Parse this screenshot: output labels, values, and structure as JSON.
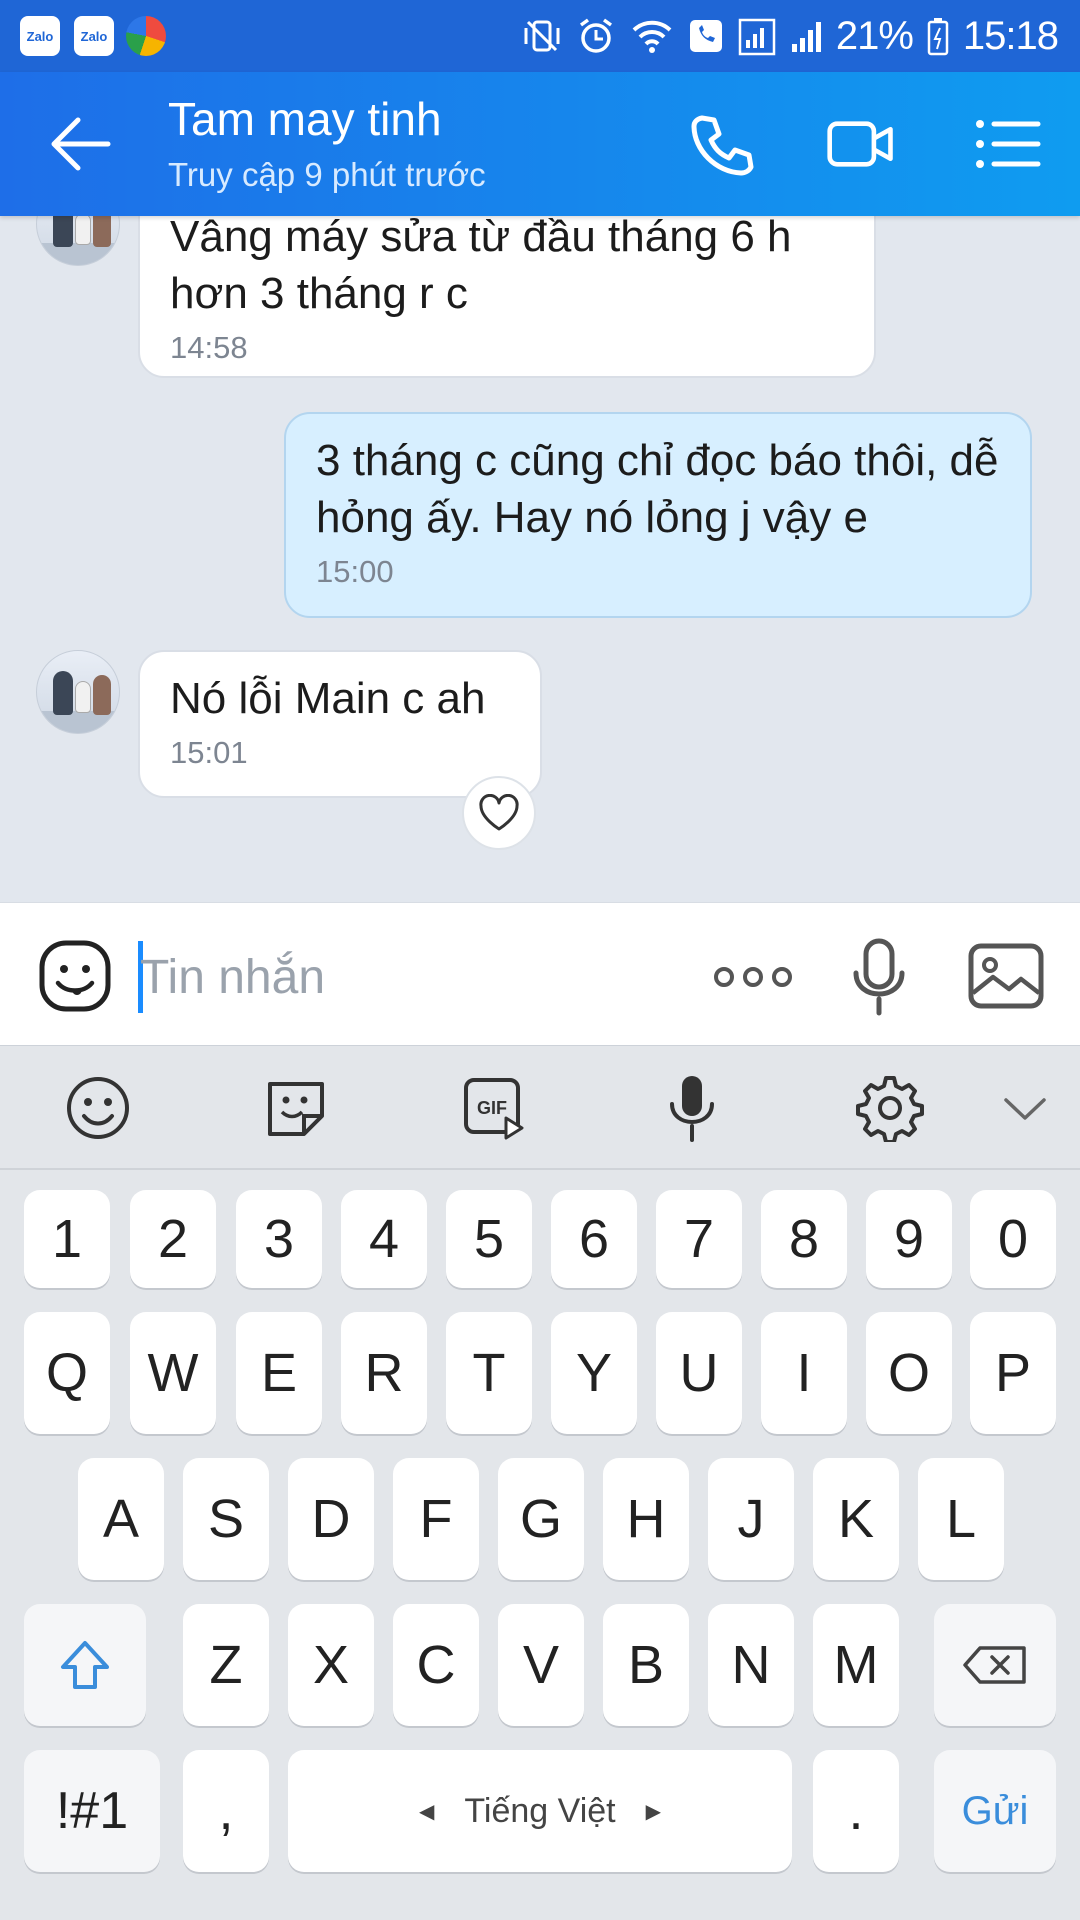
{
  "status_bar": {
    "apps": [
      "Zalo",
      "Zalo"
    ],
    "battery": "21%",
    "time": "15:18"
  },
  "header": {
    "title": "Tam may tinh",
    "subtitle": "Truy cập 9 phút trước"
  },
  "messages": [
    {
      "direction": "in",
      "text": "Vâng máy sửa từ đầu tháng 6 h hơn 3 tháng r c",
      "time": "14:58"
    },
    {
      "direction": "out",
      "text": "3 tháng c cũng chỉ đọc báo thôi, dễ hỏng ấy. Hay nó lỏng j vậy e",
      "time": "15:00"
    },
    {
      "direction": "in",
      "text": "Nó lỗi Main c ah",
      "time": "15:01"
    }
  ],
  "composer": {
    "placeholder": "Tin nhắn",
    "value": ""
  },
  "keyboard": {
    "toolbar_icons": [
      "emoji-icon",
      "sticker-icon",
      "gif-icon",
      "voice-input-icon",
      "settings-icon",
      "collapse-icon"
    ],
    "number_row": [
      "1",
      "2",
      "3",
      "4",
      "5",
      "6",
      "7",
      "8",
      "9",
      "0"
    ],
    "row1": [
      "Q",
      "W",
      "E",
      "R",
      "T",
      "Y",
      "U",
      "I",
      "O",
      "P"
    ],
    "row2": [
      "A",
      "S",
      "D",
      "F",
      "G",
      "H",
      "J",
      "K",
      "L"
    ],
    "row3": [
      "Z",
      "X",
      "C",
      "V",
      "B",
      "N",
      "M"
    ],
    "symbols_key": "!#1",
    "comma_key": ",",
    "space_label": "Tiếng Việt",
    "period_key": ".",
    "send_key": "Gửi"
  },
  "colors": {
    "header_start": "#1e6ee8",
    "header_end": "#0f9cf0",
    "status_bar": "#1f66d6",
    "outgoing_bubble": "#d7efff",
    "incoming_bubble": "#ffffff",
    "chat_background": "#e2e7ee",
    "accent": "#3a8ddb"
  }
}
